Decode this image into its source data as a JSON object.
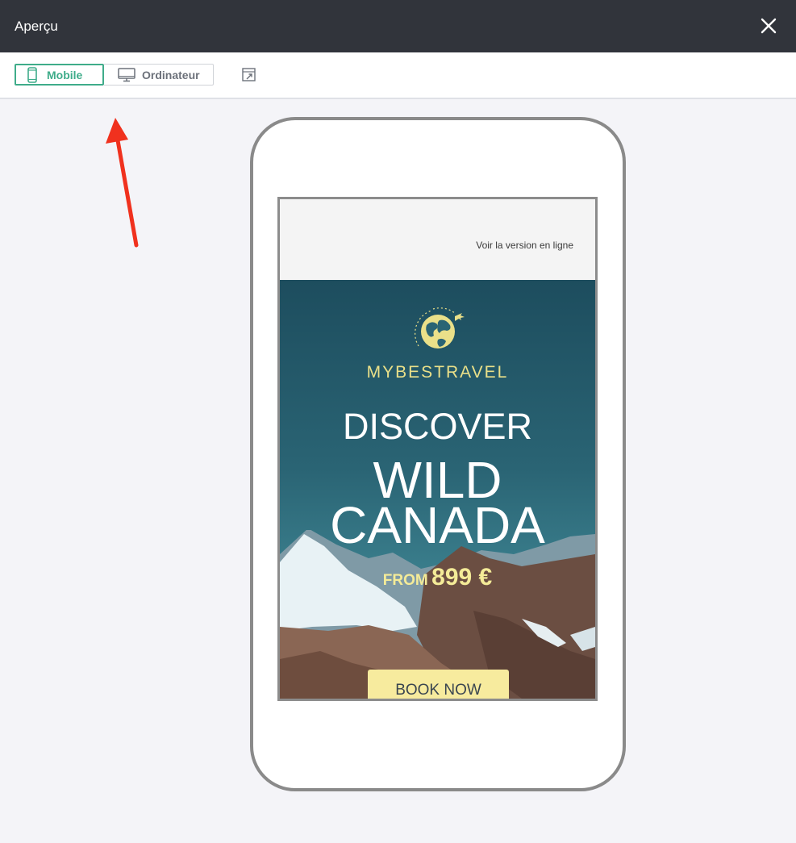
{
  "window": {
    "title": "Aperçu"
  },
  "toolbar": {
    "tabs": [
      {
        "label": "Mobile",
        "active": true
      },
      {
        "label": "Ordinateur",
        "active": false
      }
    ]
  },
  "email": {
    "preheader_link": "Voir la version en ligne",
    "brand": "MYBESTRAVEL",
    "headline_1": "DISCOVER",
    "headline_2": "WILD",
    "headline_3": "CANADA",
    "price_prefix": "FROM",
    "price_value": "899 €",
    "cta_label": "BOOK NOW"
  },
  "colors": {
    "titlebar": "#31343b",
    "accent": "#3fac8a",
    "hero": "#2a6474",
    "brand_yellow": "#eae089",
    "cta": "#f7eb9e",
    "annotation_arrow": "#f0311e"
  }
}
